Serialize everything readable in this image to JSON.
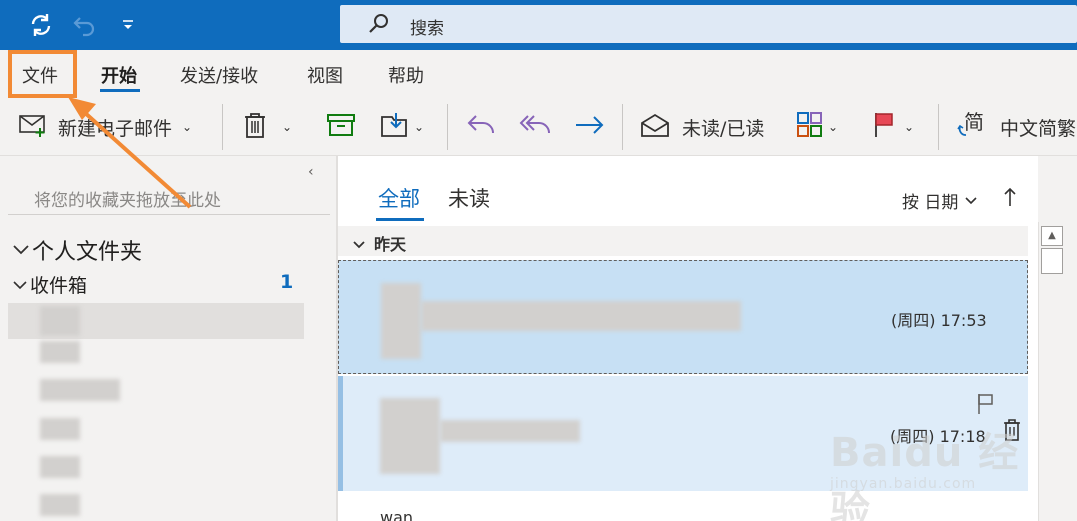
{
  "titlebar": {
    "icons": [
      "sync-icon",
      "undo-icon",
      "customize-dropdown-icon"
    ],
    "search_placeholder": "搜索"
  },
  "tabs": {
    "file": "文件",
    "home": "开始",
    "send_receive": "发送/接收",
    "view": "视图",
    "help": "帮助",
    "active": "开始"
  },
  "ribbon": {
    "new_mail": "新建电子邮件",
    "unread_read": "未读/已读",
    "translate": "中文简繁"
  },
  "leftpane": {
    "favorites_hint": "将您的收藏夹拖放至此处",
    "personal_folders": "个人文件夹",
    "inbox": "收件箱",
    "inbox_count": "1"
  },
  "msglist": {
    "filter_all": "全部",
    "filter_unread": "未读",
    "sort_label": "按 日期",
    "group_yesterday": "昨天",
    "messages": [
      {
        "time": "(周四) 17:53"
      },
      {
        "time": "(周四) 17:18"
      }
    ],
    "partial_text": "wan"
  },
  "watermark": {
    "main": "Baidu 经验",
    "sub": "jingyan.baidu.com"
  },
  "colors": {
    "titlebar": "#0f6cbd",
    "highlight": "#f28a35",
    "selected_message": "#c7e0f4"
  }
}
